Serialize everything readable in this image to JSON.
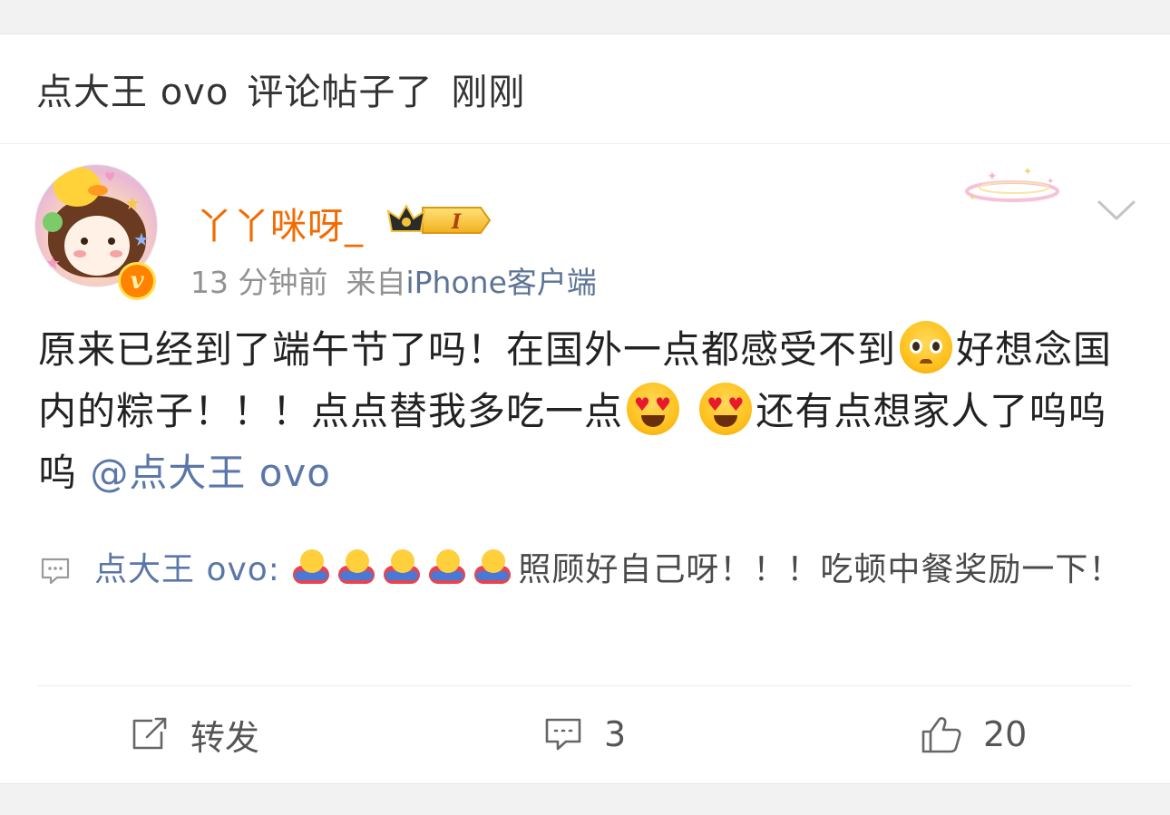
{
  "notification": {
    "actor": "点大王 ovo",
    "action": "评论帖子了",
    "time": "刚刚"
  },
  "post": {
    "author": {
      "name": "丫丫咪呀_",
      "level_badge": "I",
      "verified_icon": "v-badge-icon"
    },
    "time": "13 分钟前",
    "source_prefix": "来自",
    "source": "iPhone客户端",
    "content": {
      "part1": "原来已经到了端午节了吗！在国外一点都感受不到",
      "part2": "好想念国内的粽子！！！点点替我多吃一点",
      "part3": "还有点想家人了呜呜呜",
      "mention": "@点大王 ovo",
      "emojis": [
        "pleading-face-icon",
        "heart-eyes-icon",
        "heart-eyes-icon"
      ]
    },
    "reply": {
      "author": "点大王 ovo:",
      "emojis": [
        "hug-icon",
        "hug-icon",
        "hug-icon",
        "hug-icon",
        "hug-icon"
      ],
      "text": "照顾好自己呀！！！吃顿中餐奖励一下！"
    }
  },
  "actions": {
    "repost_label": "转发",
    "comment_count": "3",
    "like_count": "20"
  },
  "colors": {
    "username": "#f46a00",
    "link": "#5b77a7",
    "text": "#222222",
    "meta": "#929292",
    "background": "#f2f2f2"
  }
}
